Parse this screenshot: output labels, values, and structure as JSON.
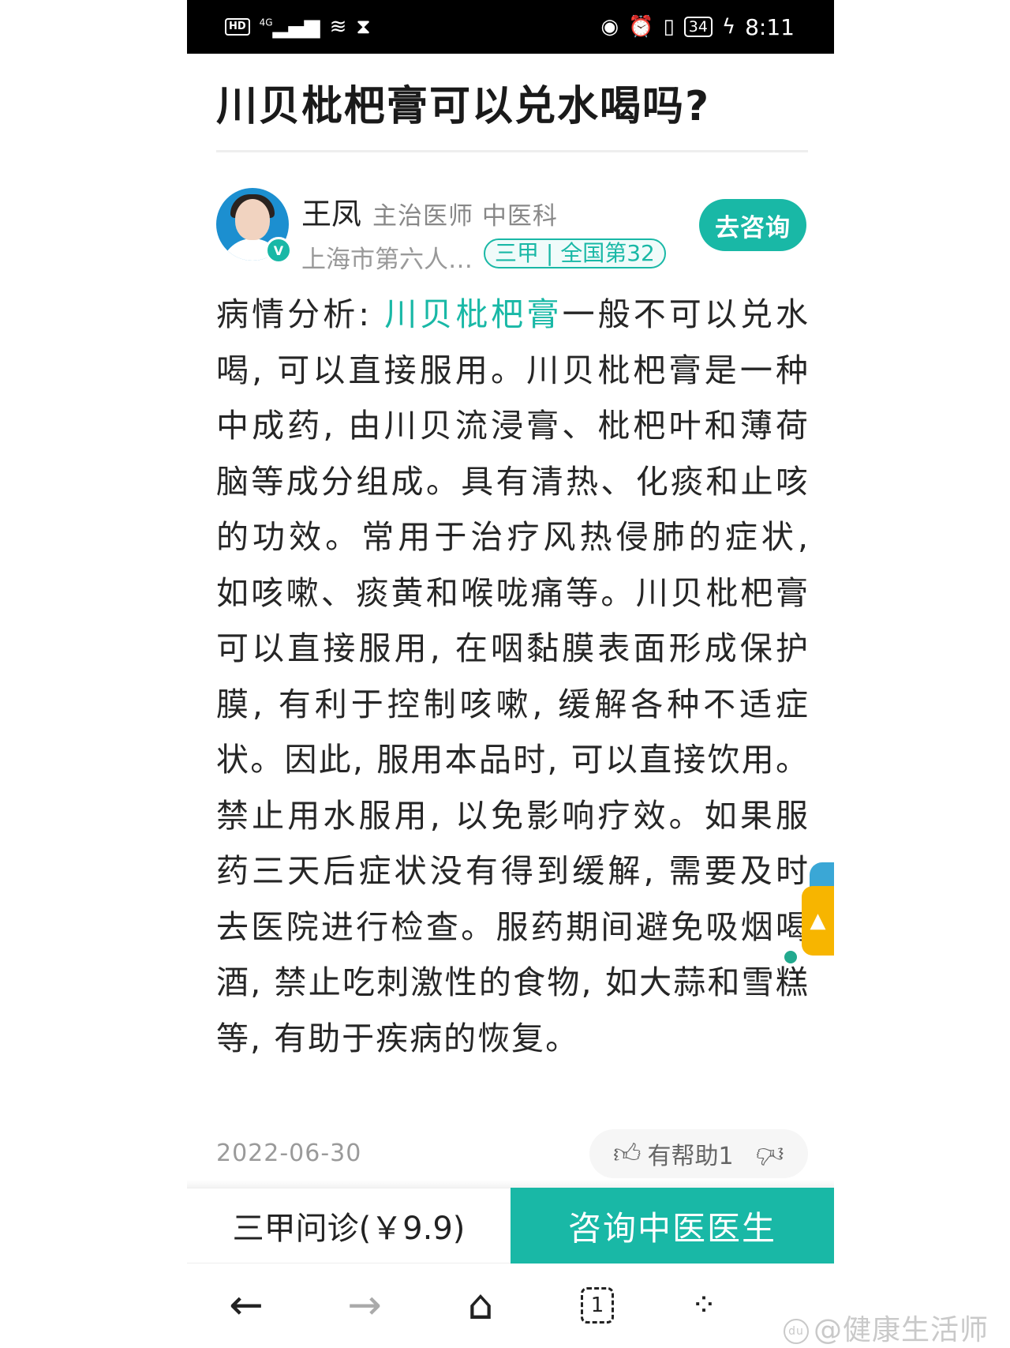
{
  "status_bar": {
    "hd": "HD",
    "network": "4G",
    "battery": "34",
    "time": "8:11"
  },
  "article": {
    "title": "川贝枇杷膏可以兑水喝吗?"
  },
  "doctor": {
    "name": "王凤",
    "title": "主治医师  中医科",
    "hospital": "上海市第六人民医院",
    "tag": "三甲 | 全国第32",
    "verified_mark": "V",
    "consult_button": "去咨询"
  },
  "analysis": {
    "prefix": "病情分析: ",
    "drug_link": "川贝枇杷膏",
    "text": "一般不可以兑水喝, 可以直接服用。川贝枇杷膏是一种中成药, 由川贝流浸膏、枇杷叶和薄荷脑等成分组成。具有清热、化痰和止咳的功效。常用于治疗风热侵肺的症状, 如咳嗽、痰黄和喉咙痛等。川贝枇杷膏可以直接服用, 在咽黏膜表面形成保护膜, 有利于控制咳嗽, 缓解各种不适症状。因此, 服用本品时, 可以直接饮用。禁止用水服用, 以免影响疗效。如果服药三天后症状没有得到缓解, 需要及时去医院进行检查。服药期间避免吸烟喝酒, 禁止吃刺激性的食物, 如大蒜和雪糕等, 有助于疾病的恢复。"
  },
  "footer": {
    "date": "2022-06-30",
    "helpful_label": "有帮助1"
  },
  "actions": {
    "left_label": "三甲问诊(￥9.9)",
    "right_label": "咨询中医医生"
  },
  "nav": {
    "tab_count": "1"
  },
  "watermark": {
    "logo": "du",
    "text": "@健康生活师"
  },
  "icons": {
    "thumb_up": "thumb-up-icon",
    "thumb_down": "thumb-down-icon",
    "back": "arrow-left-icon",
    "forward": "arrow-right-icon",
    "home": "home-icon",
    "tabs": "tabs-icon",
    "menu": "dots-grid-icon"
  },
  "colors": {
    "accent": "#19b8a6",
    "status_bar": "#000000",
    "widget": "#f7b500"
  }
}
